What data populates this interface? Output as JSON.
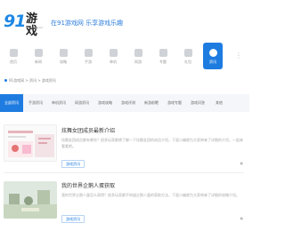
{
  "header": {
    "logo_number": "91",
    "logo_text": "游戏",
    "logo_sub": "91youxi.com",
    "slogan": "在91游戏网  乐享游戏乐趣",
    "brand_color": "#1e7ce0"
  },
  "nav": {
    "items": [
      {
        "label": "首页",
        "icon": "home-icon"
      },
      {
        "label": "新闻",
        "icon": "news-icon"
      },
      {
        "label": "攻略",
        "icon": "guide-icon"
      },
      {
        "label": "手游",
        "icon": "mobile-game-icon"
      },
      {
        "label": "单机",
        "icon": "pc-game-icon"
      },
      {
        "label": "网游",
        "icon": "online-game-icon"
      },
      {
        "label": "专题",
        "icon": "topic-icon"
      },
      {
        "label": "礼包",
        "icon": "gift-icon"
      },
      {
        "label": "软件",
        "icon": "software-icon"
      },
      {
        "label": "资讯",
        "icon": "info-icon",
        "active": true
      }
    ],
    "more": "⋮"
  },
  "breadcrumb": "91游戏网 > 资讯 > 游戏资讯",
  "tabs": [
    "全部资讯",
    "手游资讯",
    "单机资讯",
    "网游资讯",
    "游戏攻略",
    "游戏评测",
    "新游前瞻",
    "游戏专题",
    "游戏问答",
    "其他"
  ],
  "articles": [
    {
      "title": "炫舞女团成员最新介绍",
      "desc": "炫舞女团成员都有哪些？很多玩家都想了解一下炫舞女团的成员介绍，下面小编就为大家带来了详细的介绍，一起来看看吧。",
      "tag": "游戏资讯",
      "views": "●"
    },
    {
      "title": "我的世界企鹅人蛋获取",
      "desc": "我的世界企鹅人蛋怎么获得？很多玩家都不知道企鹅人蛋的获取方法，下面小编就为大家带来了详细的攻略介绍。",
      "tag": "游戏资讯",
      "views": "●"
    }
  ]
}
